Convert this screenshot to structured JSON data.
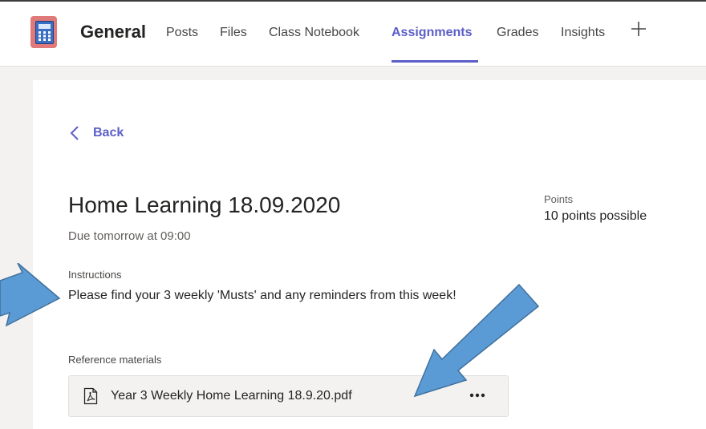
{
  "header": {
    "team_name": "General",
    "tabs": [
      {
        "label": "Posts"
      },
      {
        "label": "Files"
      },
      {
        "label": "Class Notebook"
      },
      {
        "label": "Assignments",
        "active": true
      },
      {
        "label": "Grades"
      },
      {
        "label": "Insights"
      }
    ]
  },
  "assignment": {
    "back_label": "Back",
    "title": "Home Learning 18.09.2020",
    "due": "Due tomorrow at 09:00",
    "instructions_label": "Instructions",
    "instructions_text": "Please find your 3 weekly 'Musts' and any reminders from this week!",
    "points_label": "Points",
    "points_value": "10 points possible",
    "reference_label": "Reference materials",
    "attachment_name": "Year 3 Weekly Home Learning 18.9.20.pdf"
  },
  "colors": {
    "accent": "#5b5fc7",
    "annotation_arrow": "#5b9bd5",
    "app_icon_bg": "#e07a7a"
  },
  "icons": {
    "app": "calculator-icon",
    "add_tab": "plus-icon",
    "back": "chevron-left-icon",
    "attachment": "pdf-icon",
    "more": "more-options-icon"
  }
}
